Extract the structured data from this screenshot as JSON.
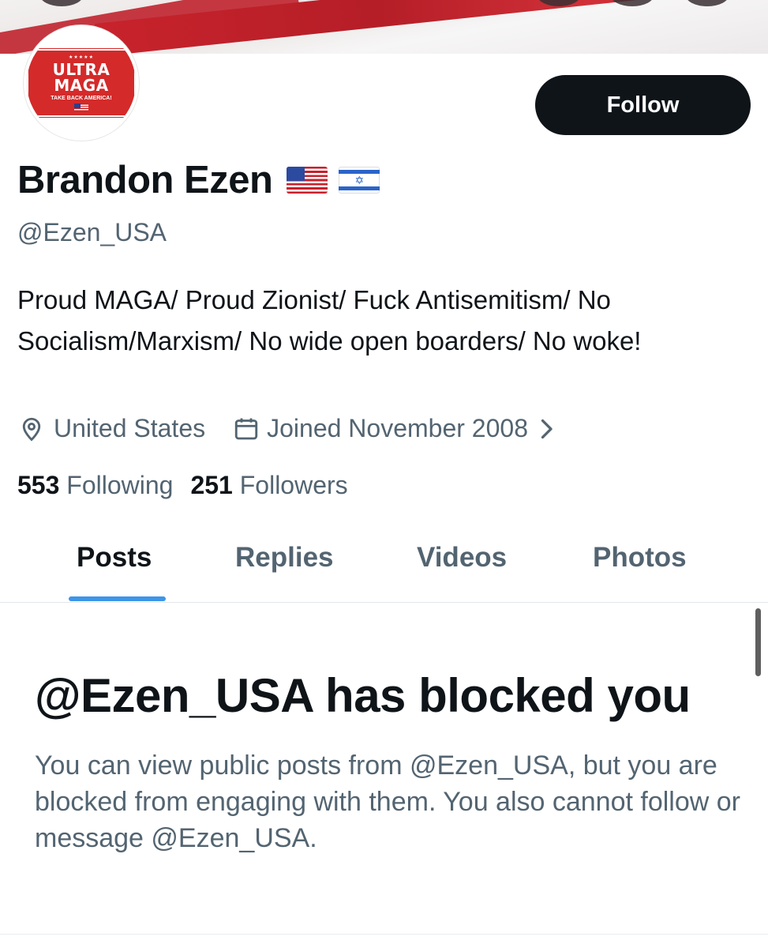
{
  "profile": {
    "avatar_text": {
      "line1": "ULTRA",
      "line2": "MAGA",
      "line3": "TAKE BACK AMERICA!"
    },
    "follow_label": "Follow",
    "display_name": "Brandon Ezen",
    "name_flags": [
      "us-flag-emoji",
      "israel-flag-emoji"
    ],
    "handle": "@Ezen_USA",
    "bio": "Proud MAGA/ Proud Zionist/ Fuck Antisemitism/ No Socialism/Marxism/ No wide open boarders/ No woke!",
    "location": "United States",
    "joined": "Joined November 2008",
    "following_count": "553",
    "following_label": "Following",
    "followers_count": "251",
    "followers_label": "Followers"
  },
  "tabs": [
    {
      "label": "Posts",
      "active": true
    },
    {
      "label": "Replies",
      "active": false
    },
    {
      "label": "Videos",
      "active": false
    },
    {
      "label": "Photos",
      "active": false
    }
  ],
  "blocked": {
    "title": "@Ezen_USA has blocked you",
    "body": "You can view public posts from @Ezen_USA, but you are blocked from engaging with them. You also cannot follow or message @Ezen_USA."
  },
  "colors": {
    "text_primary": "#0f1419",
    "text_secondary": "#536471",
    "tab_indicator": "#3d95e8",
    "button_bg": "#0f1419"
  },
  "icons": {
    "location": "location-pin-icon",
    "joined": "calendar-icon",
    "joined_more": "chevron-right-icon"
  }
}
